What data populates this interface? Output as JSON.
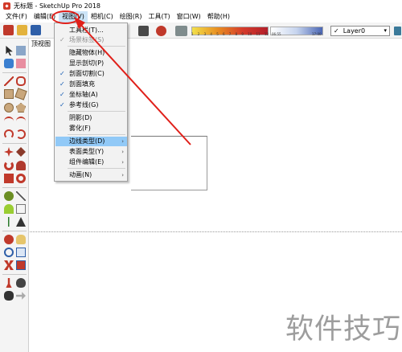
{
  "window": {
    "title": "无标题 - SketchUp Pro 2018"
  },
  "menubar": [
    {
      "label": "文件(F)"
    },
    {
      "label": "编辑(E)"
    },
    {
      "label": "视图(V)"
    },
    {
      "label": "相机(C)"
    },
    {
      "label": "绘图(R)"
    },
    {
      "label": "工具(T)"
    },
    {
      "label": "窗口(W)"
    },
    {
      "label": "帮助(H)"
    }
  ],
  "toolbar": {
    "layer": {
      "value": "Layer0",
      "check": "✓"
    },
    "shadow_scale": [
      "1",
      "2",
      "3",
      "4",
      "5",
      "6",
      "7",
      "8",
      "9",
      "10",
      "11",
      "12"
    ],
    "time_scale_start": "06:55",
    "time_scale_end": "17:00"
  },
  "viewport": {
    "view_label": "顶视图"
  },
  "view_menu": {
    "items": [
      {
        "label": "工具栏(T)...",
        "disabled": false,
        "checked": false
      },
      {
        "label": "场景标签(S)",
        "disabled": true,
        "checked": true
      },
      {
        "label": "隐藏物体(H)",
        "disabled": false,
        "checked": false
      },
      {
        "label": "显示剖切(P)",
        "disabled": false,
        "checked": false
      },
      {
        "label": "剖面切割(C)",
        "disabled": false,
        "checked": true
      },
      {
        "label": "剖面填充",
        "disabled": false,
        "checked": true
      },
      {
        "label": "坐标轴(A)",
        "disabled": false,
        "checked": true
      },
      {
        "label": "参考线(G)",
        "disabled": false,
        "checked": true
      },
      {
        "label": "阴影(D)",
        "disabled": false,
        "checked": false
      },
      {
        "label": "雾化(F)",
        "disabled": false,
        "checked": false
      },
      {
        "label": "边线类型(D)",
        "disabled": false,
        "checked": false,
        "submenu": true,
        "highlighted": true
      },
      {
        "label": "表面类型(Y)",
        "disabled": false,
        "checked": false,
        "submenu": true
      },
      {
        "label": "组件编辑(E)",
        "disabled": false,
        "checked": false,
        "submenu": true
      },
      {
        "label": "动画(N)",
        "disabled": false,
        "checked": false,
        "submenu": true
      }
    ],
    "check_glyph": "✓",
    "submenu_glyph": "›"
  },
  "watermark": "软件技巧",
  "colors": {
    "highlight": "#91c9f7",
    "annotation": "#e0201a",
    "check": "#1a5fb4"
  }
}
